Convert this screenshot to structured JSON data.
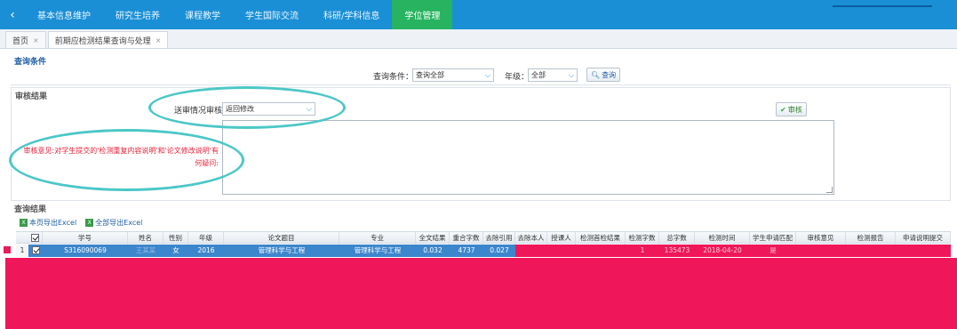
{
  "nav": {
    "items": [
      {
        "label": "基本信息维护"
      },
      {
        "label": "研究生培养"
      },
      {
        "label": "课程教学"
      },
      {
        "label": "学生国际交流"
      },
      {
        "label": "科研/学科信息"
      },
      {
        "label": "学位管理"
      }
    ],
    "active_index": 5
  },
  "tabs": [
    {
      "label": "首页"
    },
    {
      "label": "前期应检测结果查询与处理"
    }
  ],
  "query": {
    "title": "查询条件",
    "condition_label": "查询条件：",
    "condition_value": "查询全部",
    "grade_label": "年级：",
    "grade_value": "全部",
    "search_button": "查询"
  },
  "audit": {
    "title": "审核结果",
    "select_label": "送审情况审核:",
    "select_value": "返回修改",
    "approve_button": "审核",
    "question_line1": "审核意见:对学生提交的'检测重复内容说明'和'论文修改说明'有",
    "question_line2": "何疑问:"
  },
  "results": {
    "title": "查询结果",
    "export_page": "本页导出Excel",
    "export_all": "全部导出Excel",
    "columns": [
      "",
      "学号",
      "姓名",
      "性别",
      "年级",
      "论文题目",
      "专业",
      "全文结果",
      "重合字数",
      "去除引用",
      "去除本人",
      "授课人",
      "检测首检结果",
      "检测字数",
      "总字数",
      "检测时间",
      "学生申请匹配",
      "审核意见",
      "检测报告",
      "申请说明提交"
    ],
    "rows": [
      {
        "index": "1",
        "student_id": "S316090069",
        "name": "王某某",
        "gender": "女",
        "grade": "2016",
        "thesis_title": "管理科学与工程",
        "major": "管理科学与工程",
        "full_result": "0.032",
        "overlap_words": "4737",
        "remove_citation": "0.027",
        "check_words": "1",
        "total_words": "135473",
        "check_date": "2018-04-20",
        "apply_match": "是"
      }
    ]
  },
  "colors": {
    "nav_bg": "#1a8fd6",
    "nav_active": "#27b35f",
    "row_selected": "#3c86cc",
    "annotation_ellipse": "#4cc7c7",
    "question_text": "#e8223a",
    "redaction": "#f0165a"
  }
}
